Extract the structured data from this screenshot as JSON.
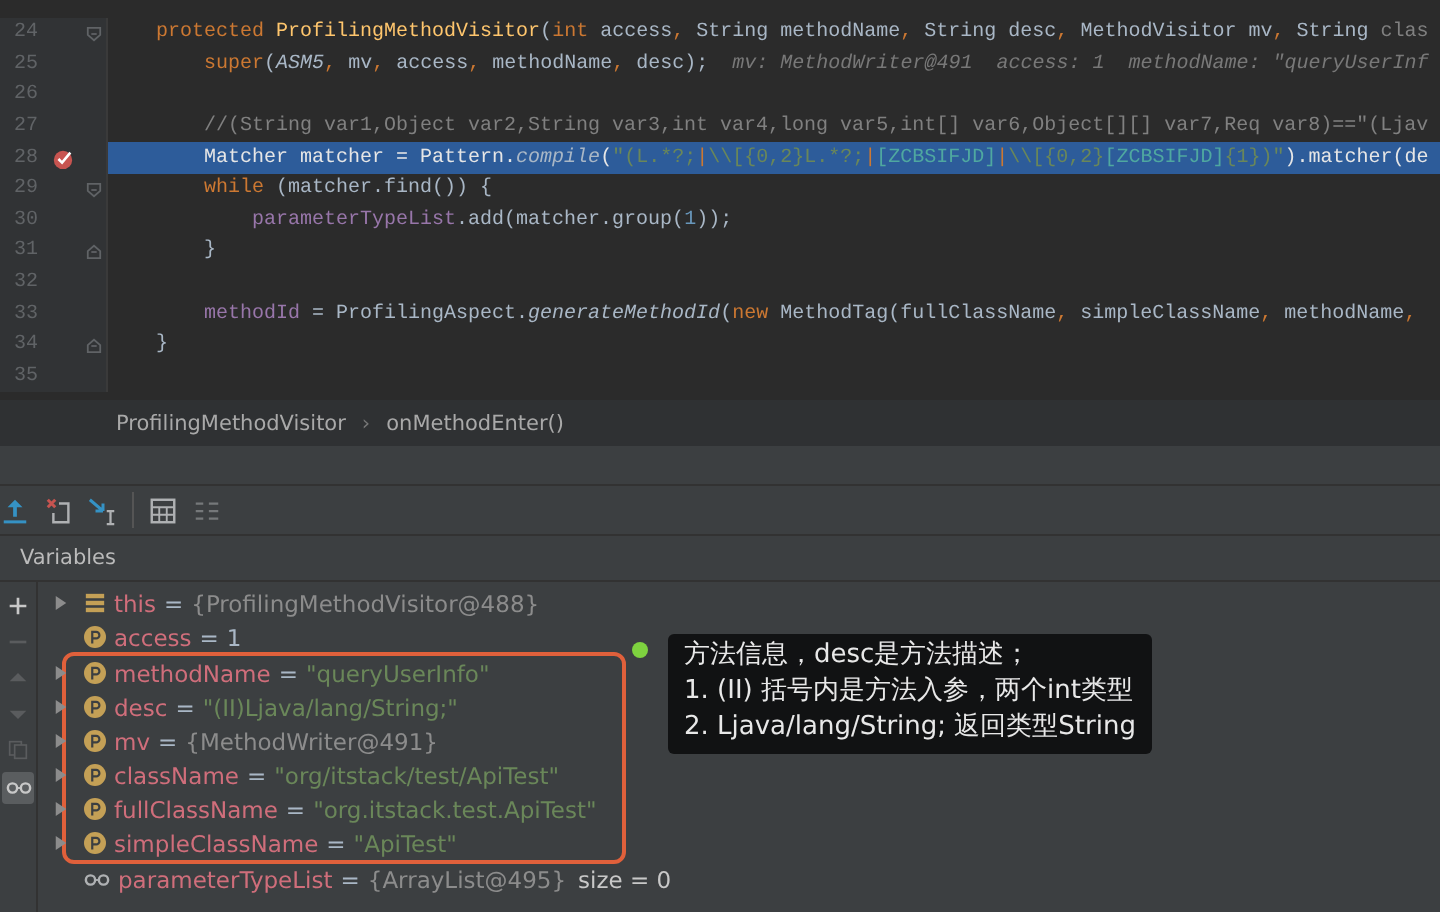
{
  "editor": {
    "lines": [
      {
        "number": "24",
        "kind": "fold-start",
        "breakpoint": false,
        "current": false,
        "tokens": [
          {
            "kind": "keyword",
            "text": "    protected "
          },
          {
            "kind": "declaration",
            "text": "ProfilingMethodVisitor"
          },
          {
            "kind": "plain",
            "text": "("
          },
          {
            "kind": "keyword",
            "text": "int"
          },
          {
            "kind": "plain",
            "text": " access"
          },
          {
            "kind": "keyword",
            "text": ","
          },
          {
            "kind": "plain",
            "text": " String methodName"
          },
          {
            "kind": "keyword",
            "text": ","
          },
          {
            "kind": "plain",
            "text": " String desc"
          },
          {
            "kind": "keyword",
            "text": ","
          },
          {
            "kind": "plain",
            "text": " MethodVisitor mv"
          },
          {
            "kind": "keyword",
            "text": ","
          },
          {
            "kind": "plain",
            "text": " String "
          },
          {
            "kind": "comment",
            "text": "clas"
          }
        ]
      },
      {
        "number": "25",
        "kind": "plain",
        "breakpoint": false,
        "current": false,
        "tokens": [
          {
            "kind": "keyword",
            "text": "        super"
          },
          {
            "kind": "plain",
            "text": "("
          },
          {
            "kind": "static",
            "text": "ASM5"
          },
          {
            "kind": "keyword",
            "text": ","
          },
          {
            "kind": "plain",
            "text": " mv"
          },
          {
            "kind": "keyword",
            "text": ","
          },
          {
            "kind": "plain",
            "text": " access"
          },
          {
            "kind": "keyword",
            "text": ","
          },
          {
            "kind": "plain",
            "text": " methodName"
          },
          {
            "kind": "keyword",
            "text": ","
          },
          {
            "kind": "plain",
            "text": " desc);"
          },
          {
            "kind": "hint",
            "text": "  mv: MethodWriter@491  access: 1  methodName: \"queryUserInf"
          }
        ]
      },
      {
        "number": "26",
        "kind": "plain",
        "breakpoint": false,
        "current": false
      },
      {
        "number": "27",
        "kind": "plain",
        "breakpoint": false,
        "current": false,
        "tokens": [
          {
            "kind": "comment",
            "text": "        //(String var1,Object var2,String var3,int var4,long var5,int[] var6,Object[][] var7,Req var8)==\"(Ljav"
          }
        ]
      },
      {
        "number": "28",
        "kind": "plain",
        "breakpoint": true,
        "current": true,
        "tokens": [
          {
            "kind": "plain",
            "text": "        Matcher matcher = Pattern."
          },
          {
            "kind": "static",
            "text": "compile"
          },
          {
            "kind": "plain",
            "text": "("
          },
          {
            "kind": "string",
            "text": "\"(L.*?;"
          },
          {
            "kind": "regex",
            "text": "|"
          },
          {
            "kind": "string",
            "text": "\\\\[{0,2}L.*?;"
          },
          {
            "kind": "regex",
            "text": "|"
          },
          {
            "kind": "charclass",
            "text": "[ZCBSIFJD]"
          },
          {
            "kind": "regex",
            "text": "|"
          },
          {
            "kind": "string",
            "text": "\\\\[{0,2}"
          },
          {
            "kind": "charclass",
            "text": "[ZCBSIFJD]"
          },
          {
            "kind": "string",
            "text": "{1})\""
          },
          {
            "kind": "plain",
            "text": ").matcher(de"
          }
        ]
      },
      {
        "number": "29",
        "kind": "fold-start",
        "breakpoint": false,
        "current": false,
        "tokens": [
          {
            "kind": "keyword",
            "text": "        while"
          },
          {
            "kind": "plain",
            "text": " (matcher.find()) {"
          }
        ]
      },
      {
        "number": "30",
        "kind": "plain",
        "breakpoint": false,
        "current": false,
        "tokens": [
          {
            "kind": "field",
            "text": "            parameterTypeList"
          },
          {
            "kind": "plain",
            "text": ".add(matcher.group("
          },
          {
            "kind": "number",
            "text": "1"
          },
          {
            "kind": "plain",
            "text": "));"
          }
        ]
      },
      {
        "number": "31",
        "kind": "fold-end",
        "breakpoint": false,
        "current": false,
        "tokens": [
          {
            "kind": "plain",
            "text": "        }"
          }
        ]
      },
      {
        "number": "32",
        "kind": "plain",
        "breakpoint": false,
        "current": false
      },
      {
        "number": "33",
        "kind": "plain",
        "breakpoint": false,
        "current": false,
        "tokens": [
          {
            "kind": "field",
            "text": "        methodId"
          },
          {
            "kind": "plain",
            "text": " = ProfilingAspect."
          },
          {
            "kind": "static",
            "text": "generateMethodId"
          },
          {
            "kind": "plain",
            "text": "("
          },
          {
            "kind": "keyword",
            "text": "new"
          },
          {
            "kind": "plain",
            "text": " MethodTag(fullClassName"
          },
          {
            "kind": "keyword",
            "text": ","
          },
          {
            "kind": "plain",
            "text": " simpleClassName"
          },
          {
            "kind": "keyword",
            "text": ","
          },
          {
            "kind": "plain",
            "text": " methodName"
          },
          {
            "kind": "keyword",
            "text": ","
          }
        ]
      },
      {
        "number": "34",
        "kind": "fold-end",
        "breakpoint": false,
        "current": false,
        "tokens": [
          {
            "kind": "plain",
            "text": "    }"
          }
        ]
      },
      {
        "number": "35",
        "kind": "plain",
        "breakpoint": false,
        "current": false
      }
    ]
  },
  "breadcrumbs": [
    "ProfilingMethodVisitor",
    "onMethodEnter()"
  ],
  "breadcrumb_separator": "›",
  "debug_toolbar": [
    {
      "kind": "step-out"
    },
    {
      "kind": "drop-frame"
    },
    {
      "kind": "run-to-cursor"
    },
    {
      "kind": "separator"
    },
    {
      "kind": "evaluate"
    },
    {
      "kind": "trace"
    }
  ],
  "variables_panel": {
    "title": "Variables",
    "side_toolbar": [
      {
        "kind": "plus",
        "disabled": false,
        "selected": false
      },
      {
        "kind": "minus",
        "disabled": true,
        "selected": false
      },
      {
        "kind": "up",
        "disabled": true,
        "selected": false
      },
      {
        "kind": "down",
        "disabled": true,
        "selected": false
      },
      {
        "kind": "copy",
        "disabled": true,
        "selected": false
      },
      {
        "kind": "watches",
        "disabled": false,
        "selected": true
      }
    ],
    "groups": [
      {
        "boxed": false,
        "rows": [
          {
            "kind": "object",
            "expandable": true,
            "name": "this",
            "separator": "=",
            "value": {
              "kind": "object",
              "text": "{ProfilingMethodVisitor@488}"
            }
          },
          {
            "kind": "primitive",
            "expandable": false,
            "name": "access",
            "separator": "=",
            "value": {
              "kind": "number",
              "text": "1"
            }
          }
        ]
      },
      {
        "boxed": true,
        "rows": [
          {
            "kind": "primitive",
            "expandable": true,
            "name": "methodName",
            "separator": "=",
            "value": {
              "kind": "string",
              "text": "\"queryUserInfo\""
            }
          },
          {
            "kind": "primitive",
            "expandable": true,
            "name": "desc",
            "separator": "=",
            "value": {
              "kind": "string",
              "text": "\"(II)Ljava/lang/String;\""
            }
          },
          {
            "kind": "primitive",
            "expandable": true,
            "name": "mv",
            "separator": "=",
            "value": {
              "kind": "object",
              "text": "{MethodWriter@491}"
            }
          },
          {
            "kind": "primitive",
            "expandable": true,
            "name": "className",
            "separator": "=",
            "value": {
              "kind": "string",
              "text": "\"org/itstack/test/ApiTest\""
            }
          },
          {
            "kind": "primitive",
            "expandable": true,
            "name": "fullClassName",
            "separator": "=",
            "value": {
              "kind": "string",
              "text": "\"org.itstack.test.ApiTest\""
            }
          },
          {
            "kind": "primitive",
            "expandable": true,
            "name": "simpleClassName",
            "separator": "=",
            "value": {
              "kind": "string",
              "text": "\"ApiTest\""
            }
          }
        ]
      },
      {
        "boxed": false,
        "rows": [
          {
            "kind": "watch",
            "expandable": false,
            "name": "parameterTypeList",
            "separator": "=",
            "value": {
              "kind": "object",
              "text": "{ArrayList@495}"
            },
            "extra": "size = 0"
          }
        ]
      }
    ],
    "note": {
      "lines": [
        "方法信息，desc是方法描述；",
        "1. (II) 括号内是方法入参，两个int类型",
        "2. Ljava/lang/String; 返回类型String"
      ]
    }
  }
}
